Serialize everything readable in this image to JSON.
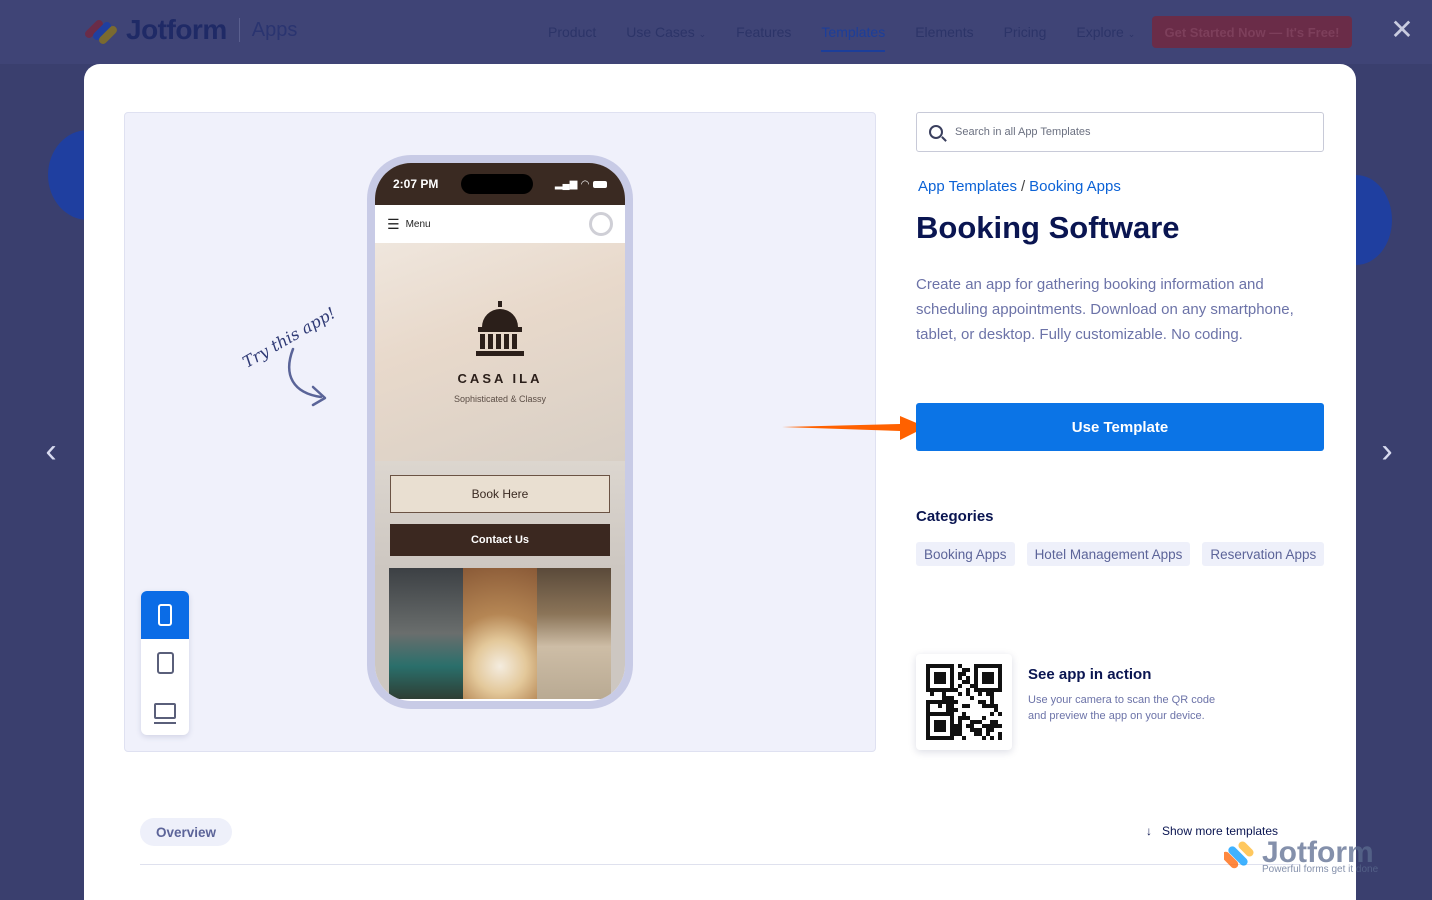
{
  "header": {
    "brand": "Jotform",
    "section": "Apps",
    "nav": [
      "Product",
      "Use Cases",
      "Features",
      "Templates",
      "Elements",
      "Pricing",
      "Explore"
    ],
    "cta": "Get Started Now — It's Free!"
  },
  "preview": {
    "try_label": "Try this app!",
    "status_time": "2:07 PM",
    "menu_label": "Menu",
    "app_name": "CASA ILA",
    "app_tagline": "Sophisticated & Classy",
    "book_button": "Book Here",
    "contact_button": "Contact Us",
    "active_device": "phone"
  },
  "search": {
    "placeholder": "Search in all App Templates"
  },
  "breadcrumbs": {
    "root": "App Templates",
    "separator": "/",
    "current": "Booking Apps"
  },
  "template": {
    "title": "Booking Software",
    "description": "Create an app for gathering booking information and scheduling appointments. Download on any smartphone, tablet, or desktop. Fully customizable. No coding.",
    "use_button": "Use Template"
  },
  "categories": {
    "heading": "Categories",
    "items": [
      "Booking Apps",
      "Hotel Management Apps",
      "Reservation Apps"
    ]
  },
  "qr": {
    "title": "See app in action",
    "description": "Use your camera to scan the QR code and preview the app on your device."
  },
  "footer": {
    "overview_tab": "Overview",
    "show_more": "Show more templates"
  },
  "watermark": {
    "brand": "Jotform",
    "tagline": "Powerful forms get it done"
  },
  "colors": {
    "primary": "#0b74e6",
    "navy": "#0a1551",
    "accent_arrow": "#ff6100",
    "overlay": "#3a3f6e"
  }
}
